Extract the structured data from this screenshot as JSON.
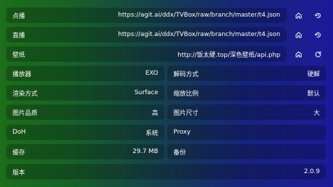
{
  "settings": {
    "vod": {
      "label": "点播",
      "value": "https://agit.ai/ddx/TVBox/raw/branch/master/t4.json"
    },
    "live": {
      "label": "直播",
      "value": "https://agit.ai/ddx/TVBox/raw/branch/master/t4.json"
    },
    "wallpaper": {
      "label": "壁纸",
      "value": "http://饭太硬.top/深色壁纸/api.php"
    },
    "player": {
      "label": "播放器",
      "value": "EXO"
    },
    "decode": {
      "label": "解码方式",
      "value": "硬解"
    },
    "render": {
      "label": "渲染方式",
      "value": "Surface"
    },
    "scale": {
      "label": "缩放比例",
      "value": "默认"
    },
    "quality": {
      "label": "图片品质",
      "value": "高"
    },
    "imgsize": {
      "label": "图片尺寸",
      "value": "大"
    },
    "doh": {
      "label": "DoH",
      "value": "系统"
    },
    "proxy": {
      "label": "Proxy",
      "value": ""
    },
    "cache": {
      "label": "缓存",
      "value": "29.7 MB"
    },
    "backup": {
      "label": "备份",
      "value": ""
    },
    "version": {
      "label": "版本",
      "value": "2.0.9"
    }
  },
  "icons": {
    "home": "home-icon",
    "history": "history-icon",
    "refresh": "refresh-icon"
  }
}
